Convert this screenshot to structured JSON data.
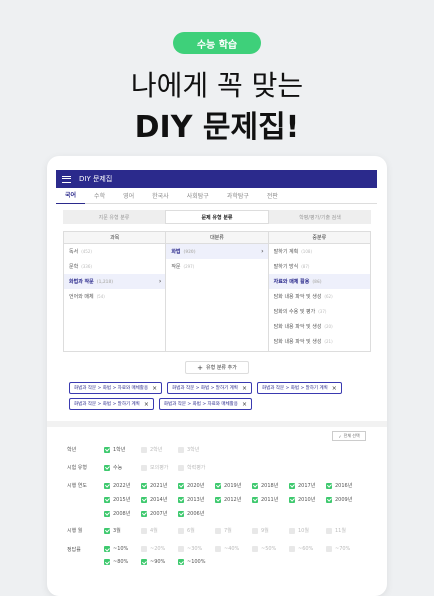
{
  "badge": "수능 학습",
  "headline1": "나에게 꼭 맞는",
  "headline2": "DIY 문제집!",
  "app": {
    "title": "DIY 문제집",
    "tabs": [
      "국어",
      "수학",
      "영어",
      "한국사",
      "사회탐구",
      "과학탐구",
      "전판"
    ],
    "segments": [
      "지문 유형 분류",
      "문제 유형 분류",
      "학평/평가/기출 검색"
    ],
    "columns": {
      "c1": {
        "head": "과목",
        "rows": [
          {
            "label": "독서",
            "count": "(452)"
          },
          {
            "label": "문학",
            "count": "(336)"
          },
          {
            "label": "화법과 작문",
            "count": "(1,218)",
            "sel": true
          },
          {
            "label": "언어와 매체",
            "count": "(54)"
          }
        ]
      },
      "c2": {
        "head": "대분류",
        "rows": [
          {
            "label": "화법",
            "count": "(920)",
            "sel": true
          },
          {
            "label": "작문",
            "count": "(297)"
          }
        ]
      },
      "c3": {
        "head": "중분류",
        "rows": [
          {
            "label": "말하기 계획",
            "count": "(108)"
          },
          {
            "label": "말하기 방식",
            "count": "(87)"
          },
          {
            "label": "자료와 매체 활용",
            "count": "(86)",
            "sel": true
          },
          {
            "label": "담화 내용 파악 및 생성",
            "count": "(62)"
          },
          {
            "label": "담화의 수용 및 평가",
            "count": "(37)"
          },
          {
            "label": "담화 내용 파악 및 생성",
            "count": "(20)"
          },
          {
            "label": "담화 내용 파악 및 생성",
            "count": "(21)"
          }
        ]
      }
    },
    "add_label": "유형 분류 추가",
    "chips": [
      "화법과 작문 > 화법 > 자료와 매체활용",
      "화법과 작문 > 화법 > 말하기 계획",
      "화법과 작문 > 화법 > 말하기 계획",
      "화법과 작문 > 화법 > 말하기 계획",
      "화법과 작문 > 화법 > 자료와 매체활용"
    ],
    "select_all": "전체 선택",
    "filters": [
      {
        "label": "학년",
        "options": [
          {
            "t": "1학년",
            "on": true
          },
          {
            "t": "2학년",
            "on": false
          },
          {
            "t": "3학년",
            "on": false
          }
        ]
      },
      {
        "label": "시험 유형",
        "options": [
          {
            "t": "수능",
            "on": true
          },
          {
            "t": "모의평가",
            "on": false
          },
          {
            "t": "학력평가",
            "on": false
          }
        ]
      },
      {
        "label": "시행 연도",
        "options": [
          {
            "t": "2022년",
            "on": true
          },
          {
            "t": "2021년",
            "on": true
          },
          {
            "t": "2020년",
            "on": true
          },
          {
            "t": "2019년",
            "on": true
          },
          {
            "t": "2018년",
            "on": true
          },
          {
            "t": "2017년",
            "on": true
          },
          {
            "t": "2016년",
            "on": true
          },
          {
            "t": "2015년",
            "on": true
          },
          {
            "t": "2014년",
            "on": true
          },
          {
            "t": "2013년",
            "on": true
          },
          {
            "t": "2012년",
            "on": true
          },
          {
            "t": "2011년",
            "on": true
          },
          {
            "t": "2010년",
            "on": true
          },
          {
            "t": "2009년",
            "on": true
          },
          {
            "t": "2008년",
            "on": true
          },
          {
            "t": "2007년",
            "on": true
          },
          {
            "t": "2006년",
            "on": true
          }
        ]
      },
      {
        "label": "시행 월",
        "options": [
          {
            "t": "3월",
            "on": true
          },
          {
            "t": "4월",
            "on": false
          },
          {
            "t": "6월",
            "on": false
          },
          {
            "t": "7월",
            "on": false
          },
          {
            "t": "9월",
            "on": false
          },
          {
            "t": "10월",
            "on": false
          },
          {
            "t": "11월",
            "on": false
          }
        ]
      },
      {
        "label": "정답률",
        "options": [
          {
            "t": "~10%",
            "on": true
          },
          {
            "t": "~20%",
            "on": false
          },
          {
            "t": "~30%",
            "on": false
          },
          {
            "t": "~40%",
            "on": false
          },
          {
            "t": "~50%",
            "on": false
          },
          {
            "t": "~60%",
            "on": false
          },
          {
            "t": "~70%",
            "on": false
          },
          {
            "t": "~80%",
            "on": true
          },
          {
            "t": "~90%",
            "on": true
          },
          {
            "t": "~100%",
            "on": true
          }
        ]
      }
    ]
  }
}
